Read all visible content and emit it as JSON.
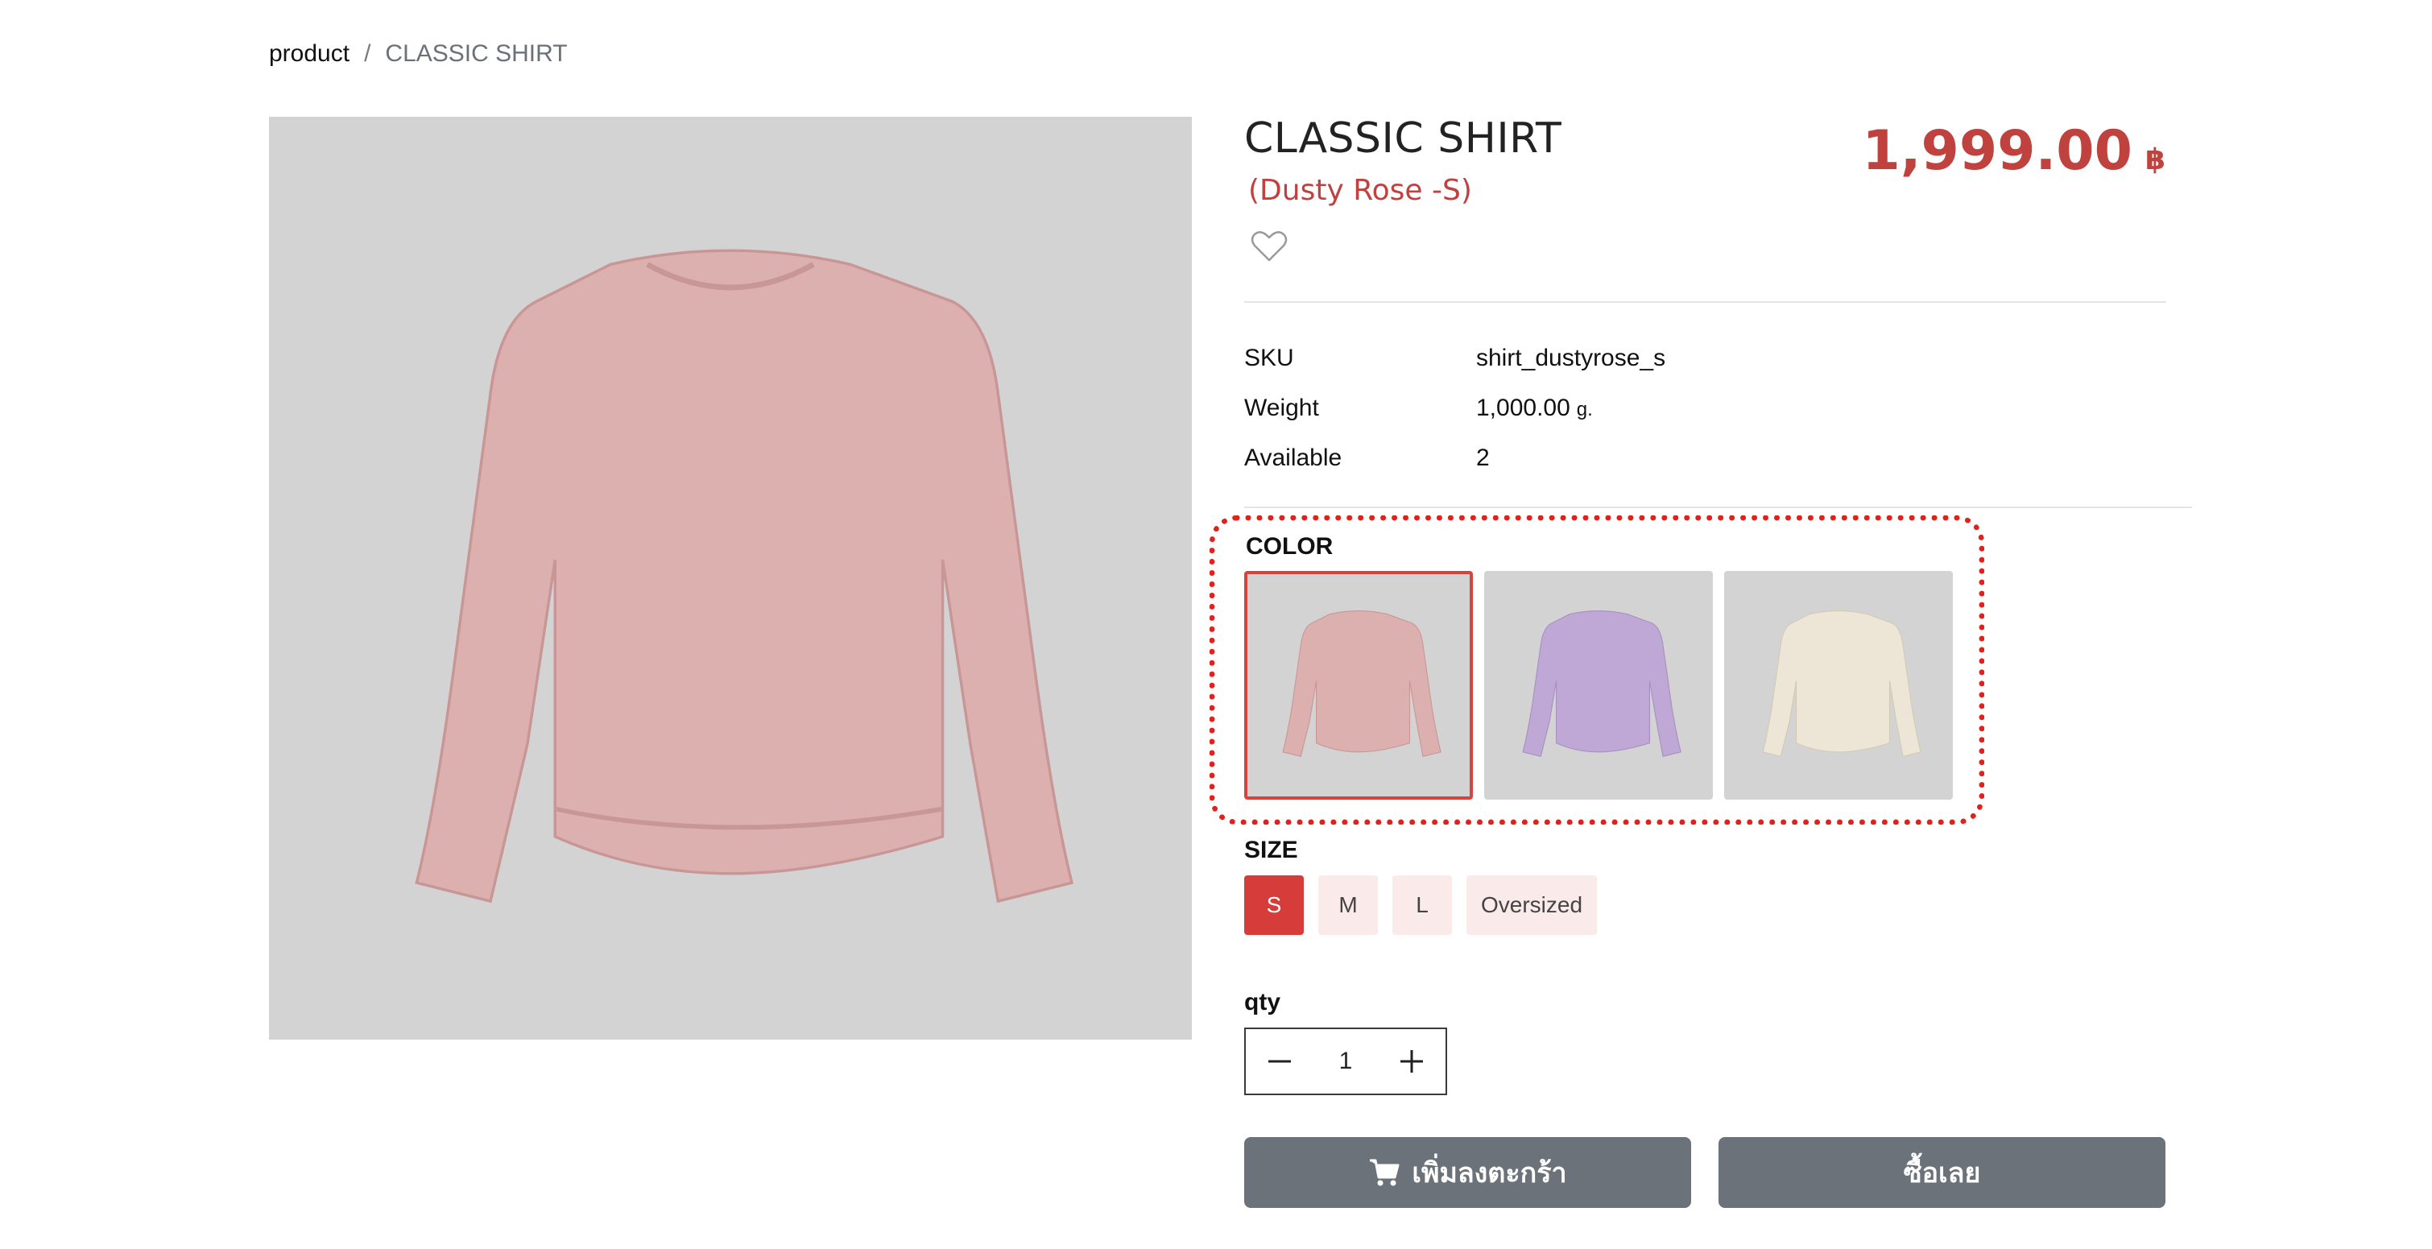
{
  "breadcrumb": {
    "parent": "product",
    "separator": "/",
    "current": "CLASSIC SHIRT"
  },
  "product": {
    "title": "CLASSIC SHIRT",
    "variant": "(Dusty Rose -S)",
    "price": "1,999.00",
    "currency": "฿",
    "main_image": {
      "icon": "sweater-image",
      "color": "#ddb0b0"
    }
  },
  "specs": [
    {
      "label": "SKU",
      "value": "shirt_dustyrose_s",
      "unit": ""
    },
    {
      "label": "Weight",
      "value": "1,000.00",
      "unit": "g."
    },
    {
      "label": "Available",
      "value": "2",
      "unit": ""
    }
  ],
  "color_section": {
    "label": "COLOR",
    "swatches": [
      {
        "name": "dusty-rose",
        "color": "#ddb0b0",
        "selected": true
      },
      {
        "name": "lavender",
        "color": "#bfa8d6",
        "selected": false
      },
      {
        "name": "cream",
        "color": "#ede6d6",
        "selected": false
      }
    ]
  },
  "size_section": {
    "label": "SIZE",
    "options": [
      "S",
      "M",
      "L",
      "Oversized"
    ],
    "selected": "S"
  },
  "qty": {
    "label": "qty",
    "value": "1"
  },
  "actions": {
    "add_to_cart": "เพิ่มลงตะกร้า",
    "buy_now": "ซื้อเลย"
  },
  "colors": {
    "accent": "#c0423f",
    "selected_size": "#d63d3a",
    "button": "#6c727a",
    "highlight": "#e1221b"
  }
}
